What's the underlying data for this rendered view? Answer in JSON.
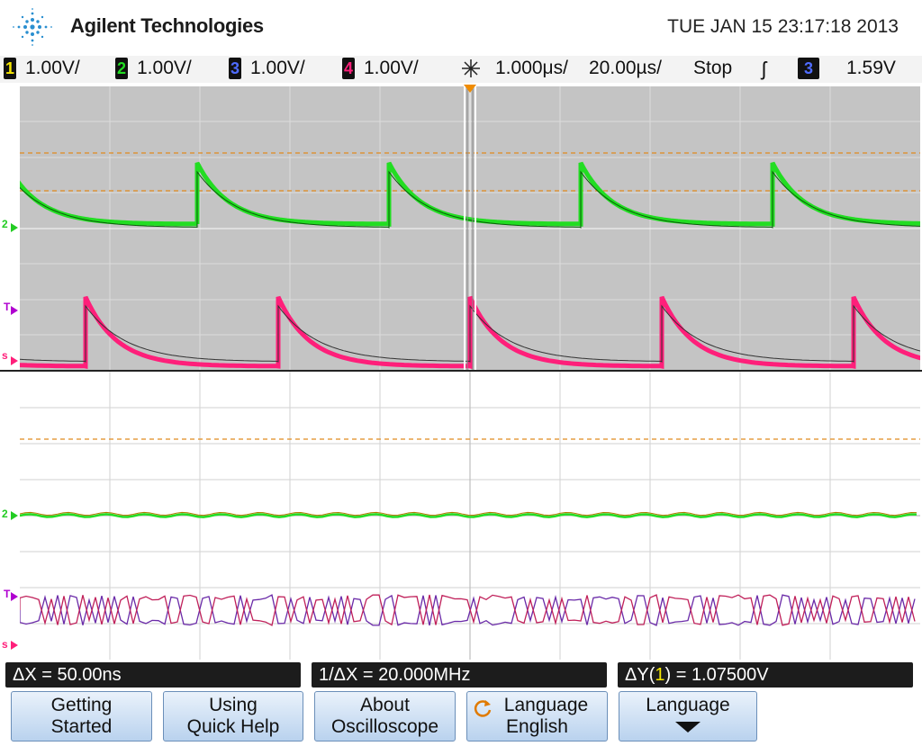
{
  "header": {
    "brand": "Agilent Technologies",
    "datetime": "TUE JAN 15 23:17:18 2013"
  },
  "channel_bar": {
    "ch1": {
      "num": "1",
      "scale": "1.00V/"
    },
    "ch2": {
      "num": "2",
      "scale": "1.00V/"
    },
    "ch3": {
      "num": "3",
      "scale": "1.00V/"
    },
    "ch4": {
      "num": "4",
      "scale": "1.00V/"
    },
    "time_delay": "1.000μs/",
    "time_scale": "20.00µs/",
    "run_state": "Stop",
    "trigger_edge": "ʃ",
    "trigger_source": "3",
    "trigger_level": "1.59V"
  },
  "markers": {
    "ch2_ground": "2",
    "trigger_T": "T",
    "ch4_ground": "s"
  },
  "status": {
    "delta_x": "ΔX = 50.00ns",
    "inv_delta_x": "1/ΔX = 20.000MHz",
    "delta_y_prefix": "ΔY(",
    "delta_y_ch": "1",
    "delta_y_suffix": ") = 1.07500V"
  },
  "softkeys": [
    {
      "line1": "Getting",
      "line2": "Started"
    },
    {
      "line1": "Using",
      "line2": "Quick Help"
    },
    {
      "line1": "About",
      "line2": "Oscilloscope"
    },
    {
      "line1": "Language",
      "line2": "English"
    },
    {
      "line1": "Language",
      "line2": ""
    }
  ],
  "colors": {
    "ch1": "#f5e600",
    "ch2": "#22dd22",
    "ch3": "#4f6cff",
    "ch4": "#ff1f7a",
    "cursor": "#e08a1e",
    "grid_bg": "#c4c4c4"
  }
}
